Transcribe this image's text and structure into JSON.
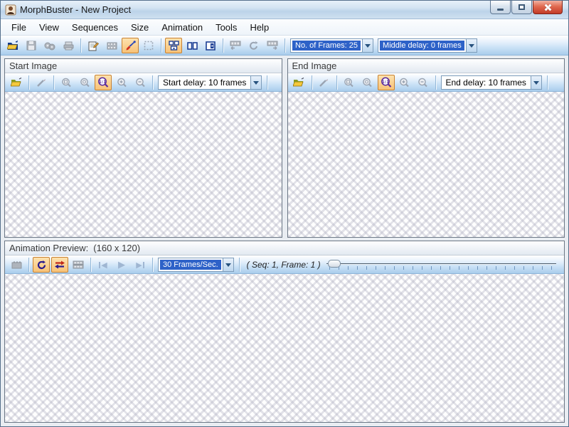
{
  "window": {
    "title": "MorphBuster - New Project",
    "controls": {
      "minimize": "minimize",
      "maximize": "maximize",
      "close": "close"
    }
  },
  "menu": {
    "items": [
      "File",
      "View",
      "Sequences",
      "Size",
      "Animation",
      "Tools",
      "Help"
    ]
  },
  "main_toolbar": {
    "buttons": [
      {
        "name": "open-project",
        "state": "enabled"
      },
      {
        "name": "save-project",
        "state": "disabled"
      },
      {
        "name": "export-images",
        "state": "disabled"
      },
      {
        "name": "print",
        "state": "disabled"
      },
      {
        "name": "project-properties",
        "state": "enabled"
      },
      {
        "name": "sequence-film",
        "state": "disabled"
      },
      {
        "name": "edit-points",
        "state": "active"
      },
      {
        "name": "select-region",
        "state": "disabled"
      },
      {
        "name": "layout-three-pane",
        "state": "active"
      },
      {
        "name": "layout-two-pane",
        "state": "enabled"
      },
      {
        "name": "layout-preview-pane",
        "state": "enabled"
      },
      {
        "name": "insert-sequence-before",
        "state": "disabled"
      },
      {
        "name": "reverse-sequence",
        "state": "disabled"
      },
      {
        "name": "insert-sequence-after",
        "state": "disabled"
      }
    ],
    "frames_combo": {
      "value": "No. of Frames: 25",
      "selected": true
    },
    "middle_delay_combo": {
      "value": "Middle delay: 0 frames",
      "selected": true
    }
  },
  "start_panel": {
    "title": "Start Image",
    "buttons": [
      {
        "name": "open-image",
        "state": "enabled"
      },
      {
        "name": "edit-wand",
        "state": "disabled"
      },
      {
        "name": "zoom-fit",
        "state": "disabled"
      },
      {
        "name": "zoom-custom",
        "state": "disabled"
      },
      {
        "name": "zoom-actual-1-1",
        "state": "active"
      },
      {
        "name": "zoom-in",
        "state": "disabled"
      },
      {
        "name": "zoom-out",
        "state": "disabled"
      }
    ],
    "delay_combo": {
      "value": "Start delay: 10 frames",
      "selected": false
    }
  },
  "end_panel": {
    "title": "End Image",
    "buttons": [
      {
        "name": "open-image",
        "state": "enabled"
      },
      {
        "name": "edit-wand",
        "state": "disabled"
      },
      {
        "name": "zoom-fit",
        "state": "disabled"
      },
      {
        "name": "zoom-custom",
        "state": "disabled"
      },
      {
        "name": "zoom-actual-1-1",
        "state": "active"
      },
      {
        "name": "zoom-in",
        "state": "disabled"
      },
      {
        "name": "zoom-out",
        "state": "disabled"
      }
    ],
    "delay_combo": {
      "value": "End delay: 10 frames",
      "selected": false
    }
  },
  "preview_panel": {
    "title": "Animation Preview:",
    "size_label": "(160 x 120)",
    "buttons": [
      {
        "name": "render-movie",
        "state": "disabled"
      },
      {
        "name": "loop-playback",
        "state": "active"
      },
      {
        "name": "pingpong-playback",
        "state": "active"
      },
      {
        "name": "filmstrip-view",
        "state": "disabled"
      },
      {
        "name": "first-frame",
        "state": "disabled"
      },
      {
        "name": "play",
        "state": "disabled"
      },
      {
        "name": "last-frame",
        "state": "disabled"
      }
    ],
    "fps_combo": {
      "value": "30 Frames/Sec.",
      "selected": true
    },
    "status": "( Seq: 1, Frame: 1 )",
    "slider": {
      "position_percent": 0,
      "frame": 1
    }
  },
  "colors": {
    "titlebar": "#cfe0f0",
    "toolbar_bottom": "#a9cdec",
    "active_button_bg": "#f8c277",
    "active_button_border": "#c98231",
    "combo_selection": "#2e62c8",
    "close_button": "#c23b27",
    "panel_border": "#6b7785"
  }
}
